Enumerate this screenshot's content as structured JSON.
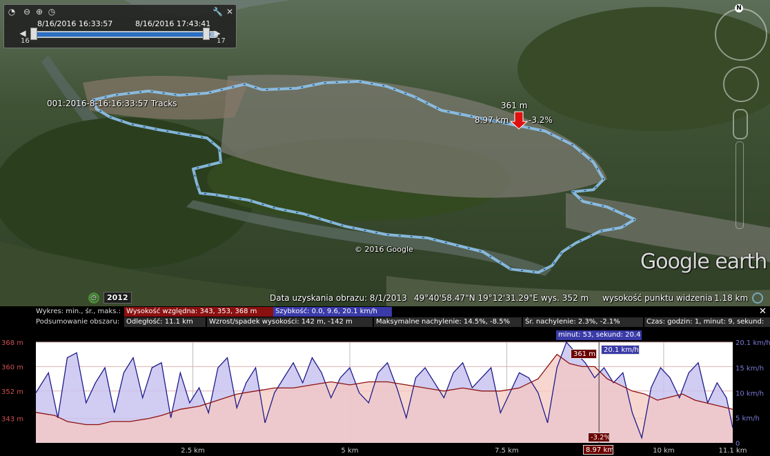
{
  "time_slider": {
    "start": "8/16/2016  16:33:57",
    "end": "8/16/2016  17:43:41",
    "left_num": "16",
    "right_num": "17"
  },
  "map": {
    "track_label": "001:2016-8-16:16:33:57   Tracks",
    "marker_elev": "361 m",
    "marker_dist": "8.97 km",
    "marker_slope": "-3.2%",
    "copyright": "© 2016 Google",
    "brand": "Google earth",
    "north": "N"
  },
  "status_bar": {
    "year": "2012",
    "imagery_date": "Data uzyskania obrazu: 8/1/2013",
    "coords": "49°40'58.47\"N   19°12'31.29\"E",
    "elevation": "wys.  352 m",
    "eye_alt_label": "wysokość punktu widzenia",
    "eye_alt": "1.18 km"
  },
  "profile": {
    "chart_label": "Wykres: min., śr., maks.:",
    "elev_badge": "Wysokość względna: 343, 353, 368 m",
    "speed_badge": "Szybkość: 0.0, 9.6, 20.1 km/h",
    "summary_label": "Podsumowanie obszaru:",
    "distance": "Odległość: 11.1 km",
    "gain_loss": "Wzrost/spadek wysokości: 142 m, -142 m",
    "max_slope": "Maksymalne nachylenie: 14.5%, -8.5%",
    "avg_slope": "Śr. nachylenie: 2.3%, -2.1%",
    "time": "Czas: godzin: 1, minut: 9, sekund:",
    "cursor_time": "minut: 53, sekund: 20.4",
    "cursor_elev": "361 m",
    "cursor_speed": "20.1 km/h",
    "cursor_slope": "-3.2%",
    "cursor_dist": "8.97 km"
  },
  "chart_data": {
    "type": "area",
    "xlabel": "",
    "x_unit": "km",
    "xlim": [
      0,
      11.1
    ],
    "x_ticks": [
      "2.5 km",
      "5 km",
      "7.5 km",
      "10 km",
      "11.1 km"
    ],
    "x_tick_values": [
      2.5,
      5,
      7.5,
      10,
      11.1
    ],
    "y_left_ticks": [
      "368 m",
      "360 m",
      "352 m",
      "343 m"
    ],
    "y_left_values": [
      368,
      360,
      352,
      343
    ],
    "ylim_left": [
      335,
      368
    ],
    "y_right_ticks": [
      "20.1 km/h",
      "15 km/h",
      "10 km/h",
      "5 km/h",
      "0"
    ],
    "y_right_values": [
      20.1,
      15,
      10,
      5,
      0
    ],
    "ylim_right": [
      0,
      20.1
    ],
    "series": [
      {
        "name": "Wysokość względna",
        "unit": "m",
        "color": "#8b1010",
        "x": [
          0,
          0.3,
          0.5,
          0.8,
          1.0,
          1.2,
          1.5,
          1.8,
          2.0,
          2.3,
          2.6,
          2.9,
          3.2,
          3.5,
          3.8,
          4.1,
          4.4,
          4.7,
          5.0,
          5.3,
          5.6,
          5.9,
          6.2,
          6.5,
          6.8,
          7.1,
          7.4,
          7.7,
          8.0,
          8.3,
          8.5,
          8.7,
          8.9,
          9.1,
          9.3,
          9.5,
          9.7,
          9.9,
          10.1,
          10.3,
          10.5,
          10.7,
          10.9,
          11.1
        ],
        "values": [
          345,
          344,
          342,
          341,
          341,
          342,
          342,
          343,
          344,
          346,
          347,
          349,
          351,
          352,
          353,
          353,
          354,
          355,
          354,
          355,
          355,
          354,
          353,
          352,
          353,
          352,
          352,
          353,
          356,
          364,
          361,
          360,
          360,
          356,
          354,
          352,
          351,
          349,
          350,
          351,
          349,
          348,
          347,
          346
        ]
      },
      {
        "name": "Szybkość",
        "unit": "km/h",
        "color": "#1a1a8a",
        "x": [
          0,
          0.2,
          0.35,
          0.5,
          0.65,
          0.8,
          0.95,
          1.1,
          1.25,
          1.4,
          1.55,
          1.7,
          1.85,
          2.0,
          2.15,
          2.3,
          2.45,
          2.6,
          2.75,
          2.9,
          3.05,
          3.2,
          3.35,
          3.5,
          3.65,
          3.8,
          3.95,
          4.1,
          4.25,
          4.4,
          4.55,
          4.7,
          4.85,
          5.0,
          5.15,
          5.3,
          5.45,
          5.6,
          5.75,
          5.9,
          6.05,
          6.2,
          6.35,
          6.5,
          6.65,
          6.8,
          6.95,
          7.1,
          7.25,
          7.4,
          7.55,
          7.7,
          7.85,
          8.0,
          8.15,
          8.3,
          8.45,
          8.6,
          8.75,
          8.9,
          9.05,
          9.2,
          9.35,
          9.5,
          9.65,
          9.8,
          9.95,
          10.1,
          10.25,
          10.4,
          10.55,
          10.7,
          10.85,
          11.0,
          11.1
        ],
        "values": [
          10,
          14,
          5,
          17,
          18,
          8,
          12,
          15,
          6,
          14,
          17,
          9,
          15,
          16,
          5,
          14,
          8,
          11,
          6,
          15,
          17,
          7,
          12,
          15,
          4,
          10,
          13,
          16,
          12,
          17,
          14,
          9,
          13,
          15,
          10,
          8,
          14,
          16,
          11,
          5,
          13,
          15,
          12,
          9,
          14,
          16,
          11,
          13,
          15,
          6,
          10,
          14,
          13,
          10,
          4,
          15,
          20.1,
          18,
          16,
          13,
          15,
          12,
          14,
          6,
          1,
          11,
          15,
          13,
          9,
          14,
          16,
          8,
          12,
          9,
          3
        ]
      }
    ]
  }
}
